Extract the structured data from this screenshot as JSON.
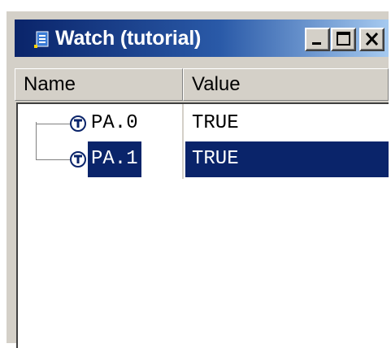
{
  "window": {
    "title": "Watch (tutorial)",
    "icon": "watch-window-icon",
    "controls": {
      "minimize": "minimize-icon",
      "maximize": "maximize-icon",
      "close": "close-icon"
    }
  },
  "columns": {
    "name": "Name",
    "value": "Value"
  },
  "rows": [
    {
      "icon": "variable-t-icon",
      "name": "PA.0",
      "value": "TRUE",
      "selected": false
    },
    {
      "icon": "variable-t-icon",
      "name": "PA.1",
      "value": "TRUE",
      "selected": true
    }
  ],
  "colors": {
    "selection": "#0a246a",
    "titlebar_start": "#0a246a",
    "titlebar_end": "#a6caf0",
    "face": "#d4d0c8"
  }
}
